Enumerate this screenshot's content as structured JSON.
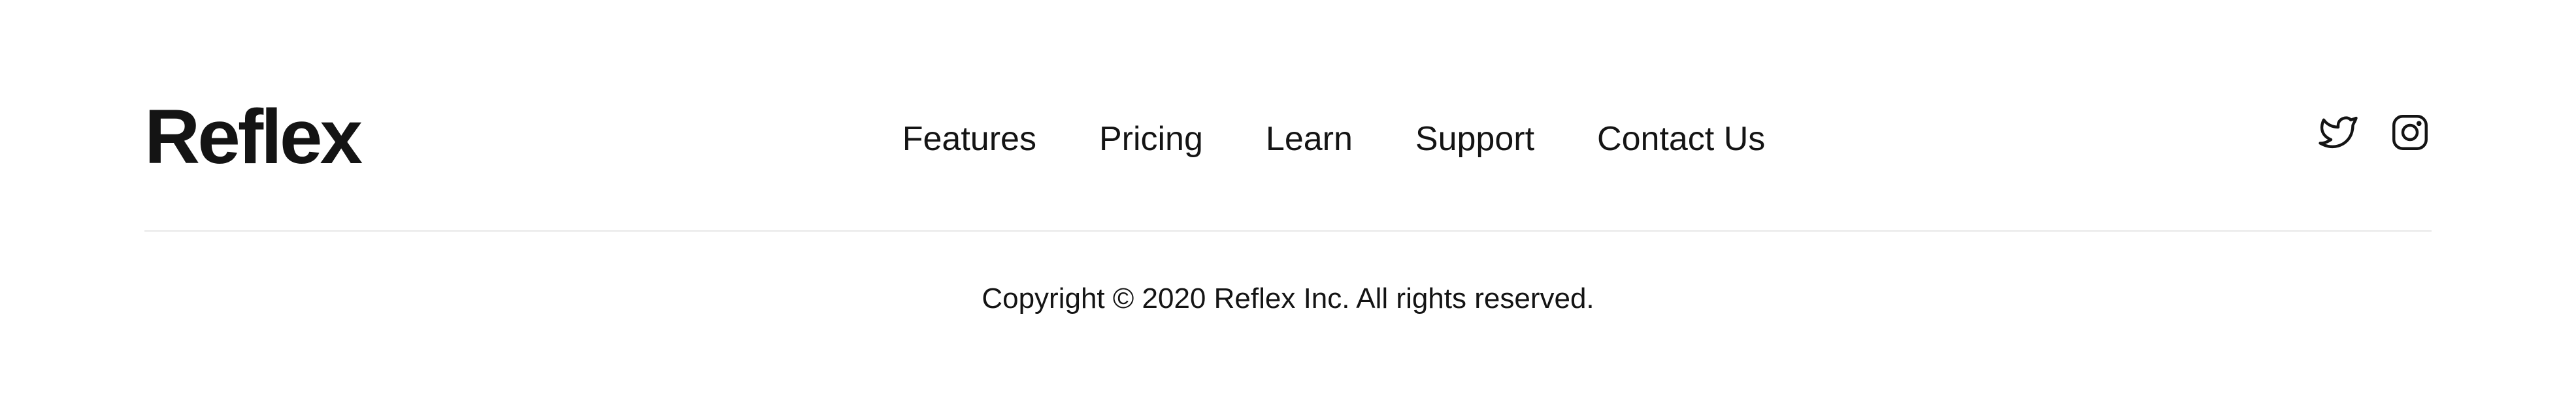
{
  "footer": {
    "logo": "Reflex",
    "nav": [
      {
        "label": "Features"
      },
      {
        "label": "Pricing"
      },
      {
        "label": "Learn"
      },
      {
        "label": "Support"
      },
      {
        "label": "Contact Us"
      }
    ],
    "social": [
      {
        "icon": "twitter-icon"
      },
      {
        "icon": "instagram-icon"
      }
    ],
    "copyright": "Copyright © 2020 Reflex Inc. All rights reserved."
  },
  "colors": {
    "text": "#141414",
    "divider": "#e8e8e8",
    "background": "#ffffff"
  }
}
